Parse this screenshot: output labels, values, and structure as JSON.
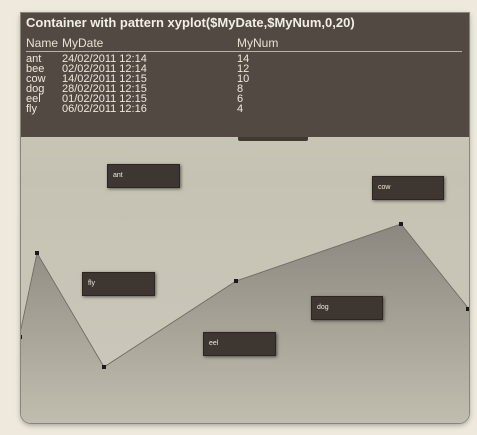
{
  "container": {
    "title": "Container with pattern xyplot($MyDate,$MyNum,0,20)"
  },
  "table": {
    "headers": [
      "Name",
      "MyDate",
      "MyNum"
    ],
    "rows": [
      {
        "name": "ant",
        "date": "24/02/2011 12:14",
        "num": "14"
      },
      {
        "name": "bee",
        "date": "02/02/2011 12:14",
        "num": "12"
      },
      {
        "name": "cow",
        "date": "14/02/2011 12:15",
        "num": "10"
      },
      {
        "name": "dog",
        "date": "28/02/2011 12:15",
        "num": "8"
      },
      {
        "name": "eel",
        "date": "01/02/2011 12:15",
        "num": "6"
      },
      {
        "name": "fly",
        "date": "06/02/2011 12:16",
        "num": "4"
      }
    ]
  },
  "colors": {
    "header_bg": "#524a42",
    "label_bg": "#3d3631",
    "area_top": "#8b877f",
    "area_bottom": "#c0bcae"
  }
}
